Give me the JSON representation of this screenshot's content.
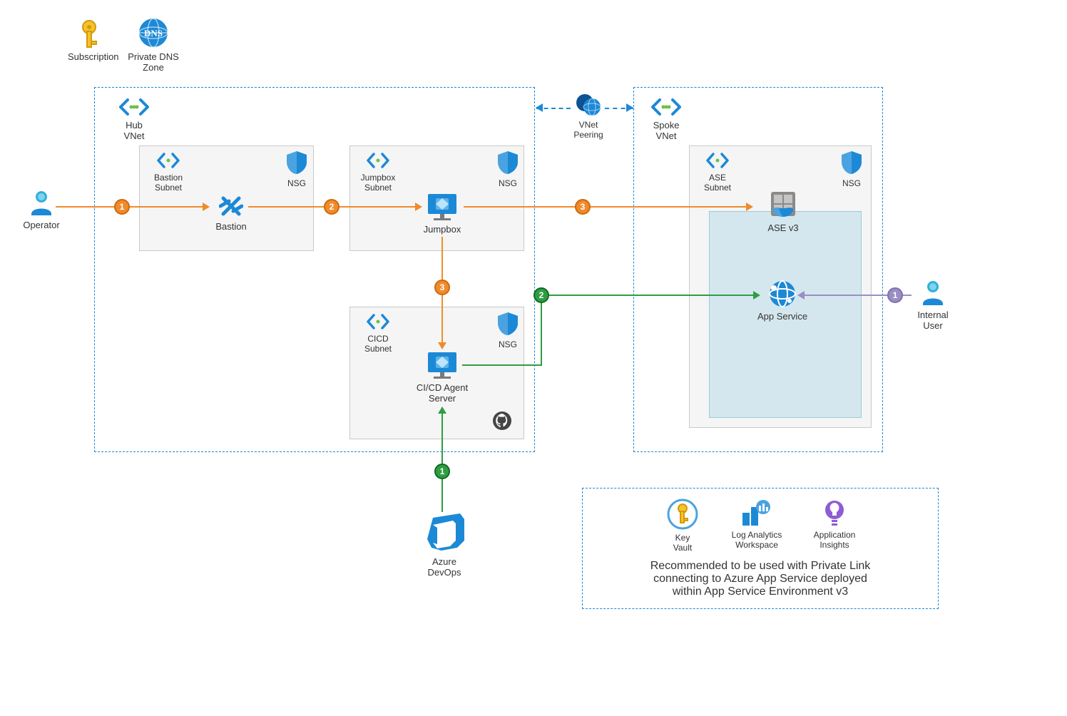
{
  "top": {
    "subscription": "Subscription",
    "dns": "Private DNS",
    "dns2": "Zone"
  },
  "hub": {
    "vnet": "Hub",
    "vnet2": "VNet",
    "bastion_subnet": "Bastion",
    "bastion_subnet2": "Subnet",
    "bastion": "Bastion",
    "nsg1": "NSG",
    "jump_subnet": "Jumpbox",
    "jump_subnet2": "Subnet",
    "jumpbox": "Jumpbox",
    "nsg2": "NSG",
    "cicd_subnet": "CICD",
    "cicd_subnet2": "Subnet",
    "cicd": "CI/CD Agent",
    "cicd2": "Server",
    "nsg3": "NSG"
  },
  "peering": {
    "label": "VNet",
    "label2": "Peering"
  },
  "spoke": {
    "vnet": "Spoke",
    "vnet2": "VNet",
    "ase_subnet": "ASE",
    "ase_subnet2": "Subnet",
    "nsg": "NSG",
    "ase": "ASE v3",
    "app": "App Service"
  },
  "people": {
    "operator": "Operator",
    "user": "Internal",
    "user2": "User"
  },
  "bottom": {
    "devops": "Azure",
    "devops2": "DevOps"
  },
  "legend": {
    "kv": "Key",
    "kv2": "Vault",
    "la": "Log Analytics",
    "la2": "Workspace",
    "ai": "Application",
    "ai2": "Insights",
    "text1": "Recommended to be used with Private Link",
    "text2": "connecting to Azure App Service deployed",
    "text3": "within App Service Environment v3"
  },
  "steps": {
    "op1": "1",
    "op2": "2",
    "op3": "3",
    "op3b": "3",
    "dev1": "1",
    "dev2": "2",
    "user1": "1"
  }
}
